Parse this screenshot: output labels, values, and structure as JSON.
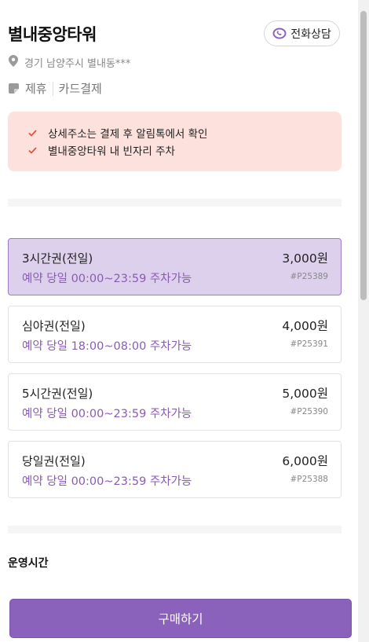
{
  "header": {
    "title": "별내중앙타워",
    "call_button_label": "전화상담"
  },
  "info": {
    "address": "경기 남양주시 별내동***",
    "payment_types": [
      "제휴",
      "카드결제"
    ]
  },
  "notice": {
    "items": [
      "상세주소는 결제 후 알림톡에서 확인",
      "별내중앙타워 내 빈자리 주차"
    ]
  },
  "tickets": [
    {
      "name": "3시간권(전일)",
      "availability": "예약 당일 00:00~23:59 주차가능",
      "price": "3,000원",
      "code": "#P25389",
      "selected": true
    },
    {
      "name": "심야권(전일)",
      "availability": "예약 당일 18:00~08:00 주차가능",
      "price": "4,000원",
      "code": "#P25391",
      "selected": false
    },
    {
      "name": "5시간권(전일)",
      "availability": "예약 당일 00:00~23:59 주차가능",
      "price": "5,000원",
      "code": "#P25390",
      "selected": false
    },
    {
      "name": "당일권(전일)",
      "availability": "예약 당일 00:00~23:59 주차가능",
      "price": "6,000원",
      "code": "#P25388",
      "selected": false
    }
  ],
  "operating_hours": {
    "title": "운영시간"
  },
  "footer": {
    "buy_button_label": "구매하기"
  },
  "colors": {
    "accent": "#8b62bb",
    "selected_bg": "#ddd0ec",
    "notice_bg": "#fde1dd",
    "check": "#e0533d"
  },
  "icons": [
    "phone-chat-icon",
    "location-pin-icon",
    "card-icon",
    "check-icon"
  ]
}
